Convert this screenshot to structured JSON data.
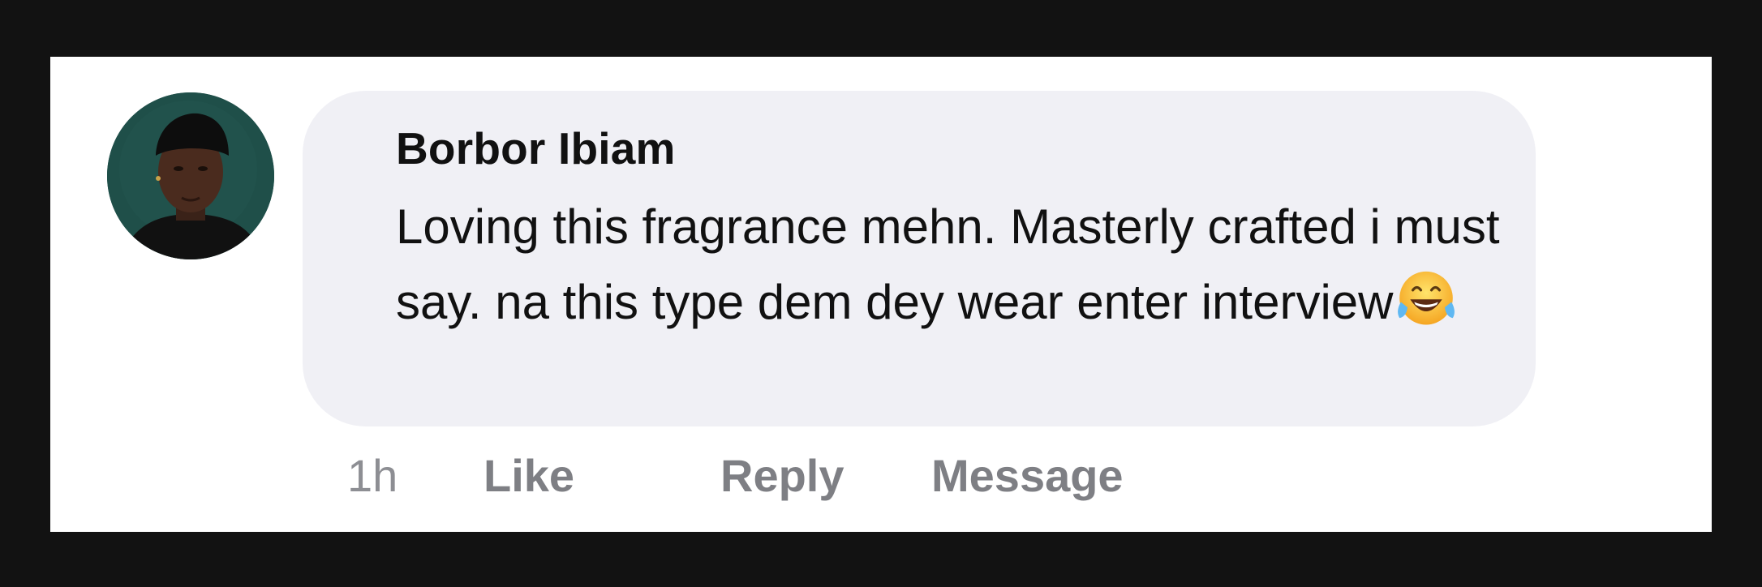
{
  "comment": {
    "author": "Borbor Ibiam",
    "text": "Loving this fragrance mehn. Masterly crafted i must say. na this type dem dey wear enter interview",
    "emoji": "face-with-tears-of-joy",
    "time": "1h"
  },
  "actions": {
    "like_label": "Like",
    "reply_label": "Reply",
    "message_label": "Message"
  },
  "colors": {
    "page_background": "#121212",
    "card_background": "#ffffff",
    "bubble_background": "#f0f0f5",
    "text": "#111111",
    "action_text": "#7e7f84"
  }
}
